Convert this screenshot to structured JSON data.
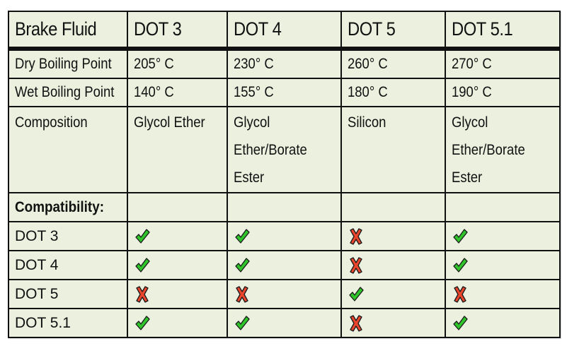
{
  "table": {
    "header": [
      "Brake Fluid",
      "DOT 3",
      "DOT 4",
      "DOT 5",
      "DOT 5.1"
    ],
    "rows": [
      {
        "label": "Dry Boiling Point",
        "values": [
          "205° C",
          "230° C",
          "260° C",
          "270° C"
        ]
      },
      {
        "label": "Wet Boiling Point",
        "values": [
          "140° C",
          "155° C",
          "180° C",
          "190° C"
        ]
      }
    ],
    "composition": {
      "label": "Composition",
      "values": [
        [
          "Glycol Ether"
        ],
        [
          "Glycol",
          "Ether/Borate",
          "Ester"
        ],
        [
          "Silicon"
        ],
        [
          "Glycol",
          "Ether/Borate",
          "Ester"
        ]
      ]
    },
    "compatibility_label": "Compatibility:",
    "compatibility": [
      {
        "label": "DOT 3",
        "values": [
          "check",
          "check",
          "cross",
          "check"
        ]
      },
      {
        "label": "DOT 4",
        "values": [
          "check",
          "check",
          "cross",
          "check"
        ]
      },
      {
        "label": "DOT 5",
        "values": [
          "cross",
          "cross",
          "check",
          "cross"
        ]
      },
      {
        "label": "DOT 5.1",
        "values": [
          "check",
          "check",
          "cross",
          "check"
        ]
      }
    ]
  },
  "colors": {
    "cell_background": "#ebf0df",
    "border": "#111111",
    "check": "#2fc42a",
    "cross": "#e8452c"
  },
  "icons": {
    "check": "check-icon",
    "cross": "cross-icon"
  }
}
